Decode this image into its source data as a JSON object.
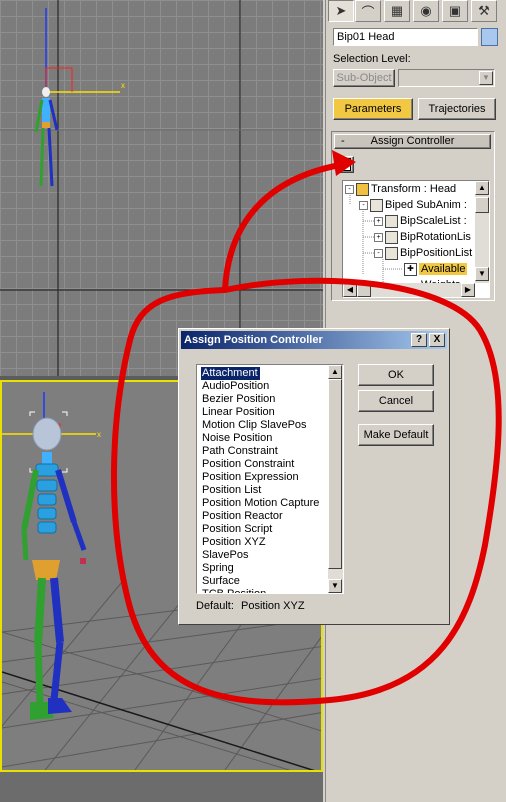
{
  "panel": {
    "object_name": "Bip01 Head",
    "selection_level_label": "Selection Level:",
    "subobject_button": "Sub-Object",
    "parameters_button": "Parameters",
    "trajectories_button": "Trajectories",
    "rollout_toggle": "-",
    "rollout_title": "Assign Controller",
    "assign_button": "?",
    "tabs": [
      "create-icon",
      "modify-icon",
      "hierarchy-icon",
      "motion-icon",
      "display-icon",
      "utilities-icon"
    ],
    "accent_color": "#f2c842",
    "color_swatch": "#a8c8f0"
  },
  "tree": {
    "rows": [
      {
        "label": "Transform : Head"
      },
      {
        "label": "Biped SubAnim :"
      },
      {
        "label": "BipScaleList :"
      },
      {
        "label": "BipRotationLis"
      },
      {
        "label": "BipPositionList"
      },
      {
        "label": "Available"
      },
      {
        "label": "Weights"
      }
    ],
    "selected_index": 5
  },
  "dialog": {
    "title": "Assign Position Controller",
    "help_button": "?",
    "close_button": "X",
    "controllers": [
      "Attachment",
      "AudioPosition",
      "Bezier Position",
      "Linear Position",
      "Motion Clip SlavePos",
      "Noise Position",
      "Path Constraint",
      "Position Constraint",
      "Position Expression",
      "Position List",
      "Position Motion Capture",
      "Position Reactor",
      "Position Script",
      "Position XYZ",
      "SlavePos",
      "Spring",
      "Surface",
      "TCB Position"
    ],
    "selected_controller": "Attachment",
    "ok_button": "OK",
    "cancel_button": "Cancel",
    "make_default_button": "Make Default",
    "default_label": "Default:",
    "default_value": "Position XYZ"
  },
  "viewport": {
    "gizmo_x_label": "x",
    "highlight_color": "#e8e000"
  },
  "annotation": {
    "color": "#e00000"
  }
}
